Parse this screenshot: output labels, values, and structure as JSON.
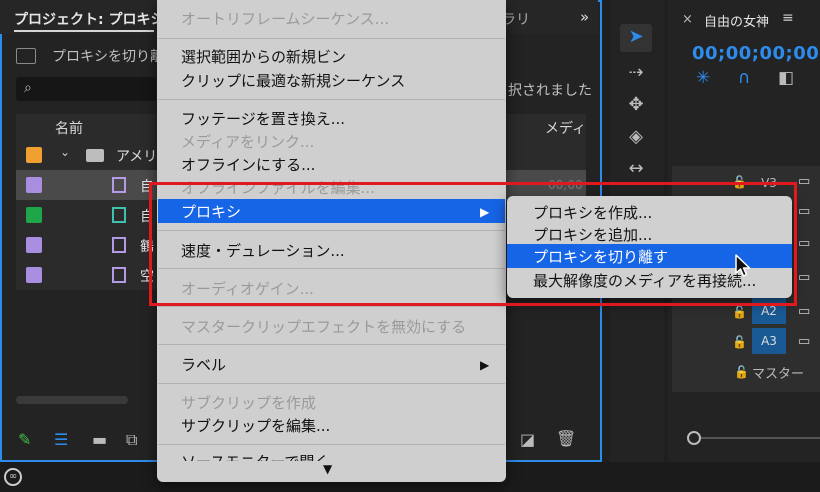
{
  "project_panel": {
    "tab_title": "プロジェクト: プロキシ",
    "tab_library": "ラリ",
    "tab_overflow": "»",
    "bin_path": "プロキシを切り離",
    "selection_status": "択されました",
    "columns": {
      "name": "名前",
      "media": "メディ"
    },
    "folder_label": "アメリ",
    "rows": [
      {
        "label": "自",
        "color": "#a98de0"
      },
      {
        "label": "自",
        "color": "#1fa64a"
      },
      {
        "label": "鶴",
        "color": "#a98de0"
      },
      {
        "label": "空",
        "color": "#a98de0"
      }
    ],
    "folder_color": "#f0a030",
    "time_dim": "00;00"
  },
  "timeline": {
    "title": "自由の女神",
    "timecode": "00;00;00;00",
    "tracks": [
      {
        "label": "V3",
        "active": false
      },
      {
        "label": "A2",
        "active": true
      },
      {
        "label": "A3",
        "active": true
      }
    ],
    "master_label": "マスター"
  },
  "context_menu": {
    "items": [
      {
        "label": "オートリフレームシーケンス...",
        "enabled": false
      },
      {
        "label": "選択範囲からの新規ビン",
        "enabled": true
      },
      {
        "label": "クリップに最適な新規シーケンス",
        "enabled": true
      },
      {
        "label": "フッテージを置き換え...",
        "enabled": true
      },
      {
        "label": "メディアをリンク...",
        "enabled": false
      },
      {
        "label": "オフラインにする...",
        "enabled": true
      },
      {
        "label": "オフラインファイルを編集...",
        "enabled": false
      },
      {
        "label": "プロキシ",
        "enabled": true,
        "highlighted": true
      },
      {
        "label": "速度・デュレーション...",
        "enabled": true
      },
      {
        "label": "オーディオゲイン...",
        "enabled": false
      },
      {
        "label": "マスタークリップエフェクトを無効にする",
        "enabled": false
      },
      {
        "label": "ラベル",
        "enabled": true
      },
      {
        "label": "サブクリップを作成",
        "enabled": false
      },
      {
        "label": "サブクリップを編集...",
        "enabled": true
      },
      {
        "label": "ソースモニターで開く",
        "enabled": true
      }
    ],
    "submenu_arrow": "▶",
    "scroll_down": "▼"
  },
  "proxy_submenu": {
    "items": [
      {
        "label": "プロキシを作成..."
      },
      {
        "label": "プロキシを追加..."
      },
      {
        "label": "プロキシを切り離す",
        "highlighted": true
      },
      {
        "label": "最大解像度のメディアを再接続..."
      }
    ]
  },
  "colors": {
    "accent": "#2d8ceb",
    "menu_highlight": "#1665e6",
    "annotation": "#e0191e"
  }
}
